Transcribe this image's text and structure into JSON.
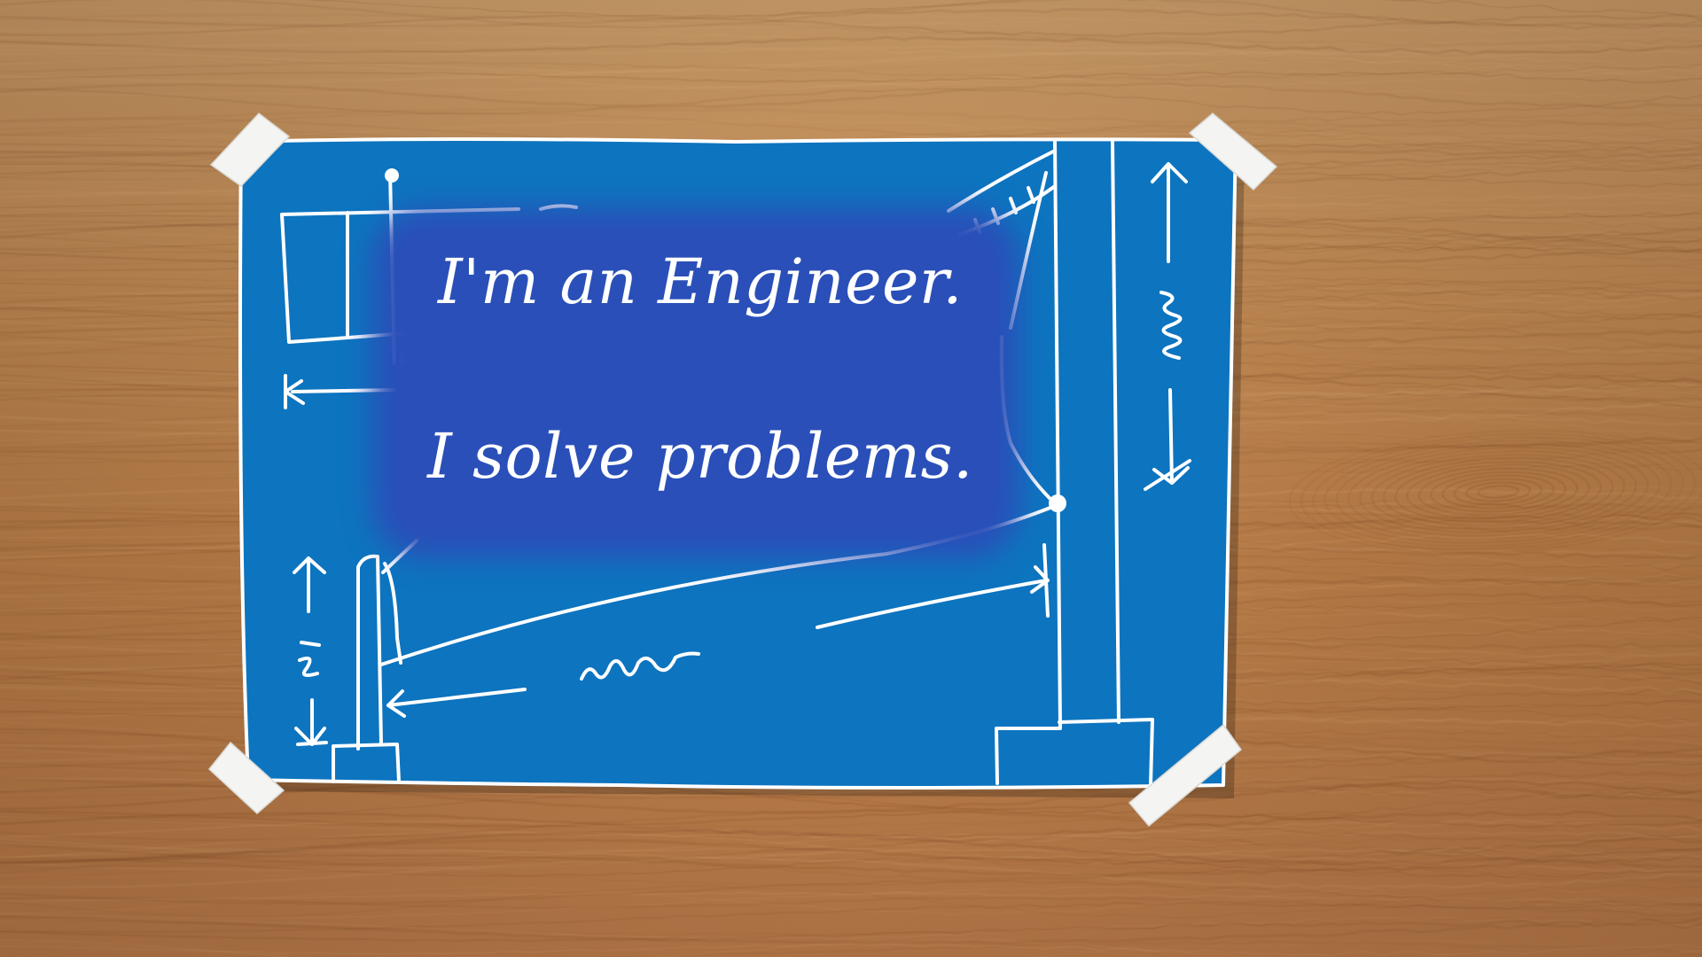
{
  "caption": {
    "line1": "I'm an Engineer.",
    "line2": "I solve problems."
  },
  "colors": {
    "desk": "#c08a55",
    "blueprint": "#0d74bf",
    "caption_highlight": "#2a4fb8",
    "ink": "#ffffff",
    "tape": "#f4f4f2"
  },
  "icons": [
    "wood-desk-background",
    "blueprint-sheet",
    "tape-strip",
    "bridge-sketch"
  ]
}
